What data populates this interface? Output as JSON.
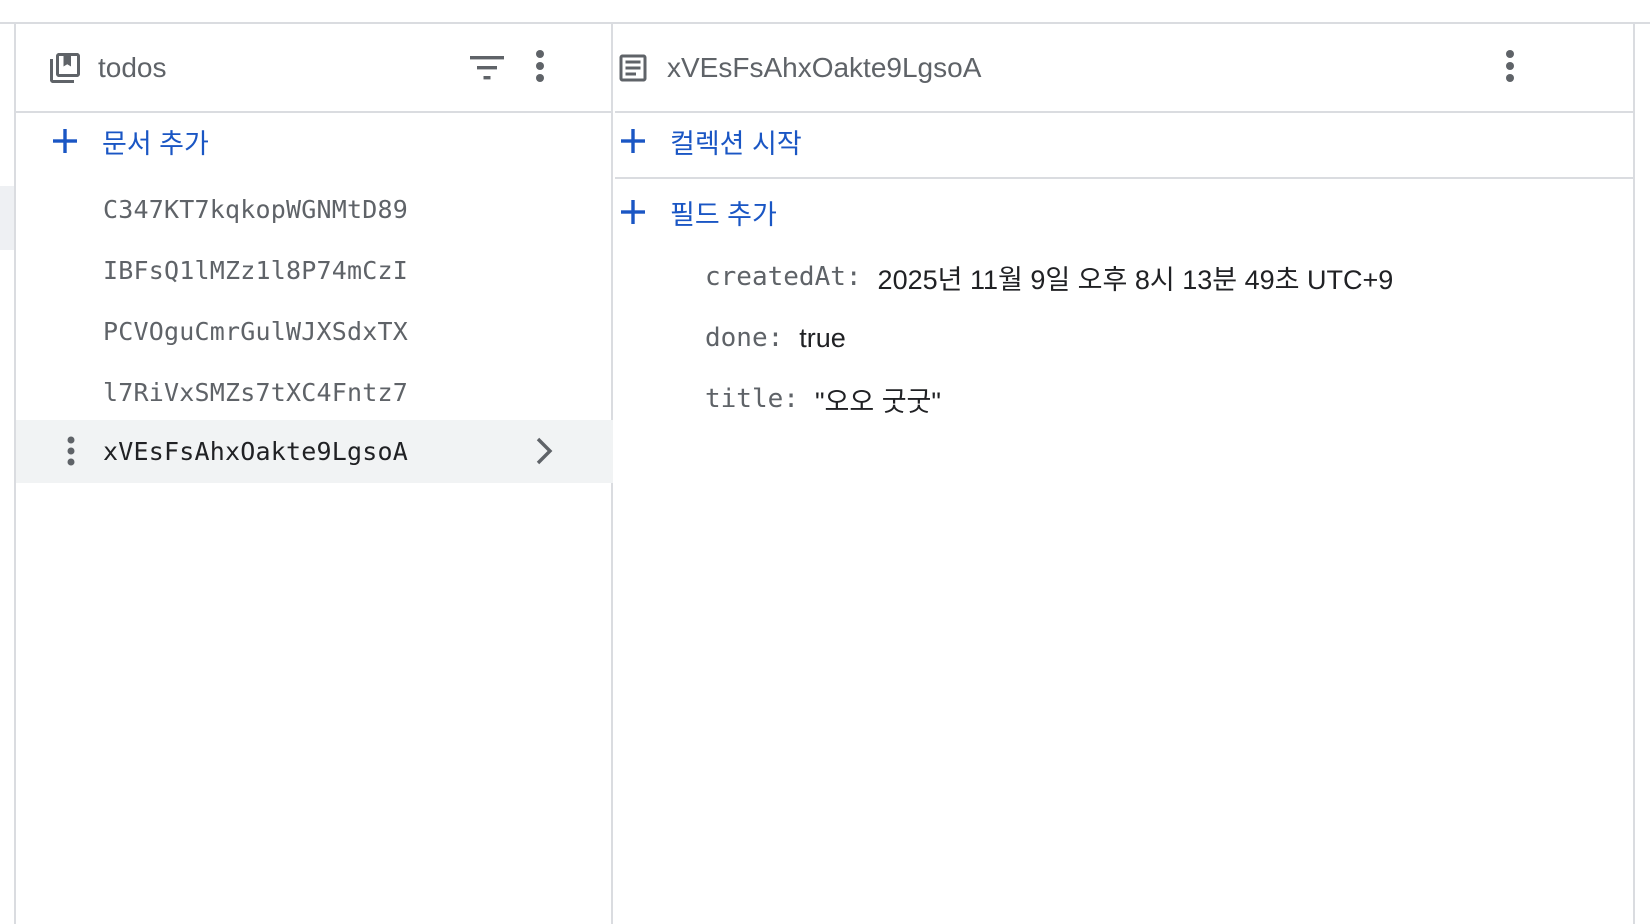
{
  "colors": {
    "accent": "#1a56c4",
    "border": "#dadce0",
    "selected_row": "#f1f3f4",
    "muted_text": "#5f6368",
    "text": "#202124"
  },
  "collection_panel": {
    "icon": "collection-icon",
    "title": "todos",
    "filter_icon": "filter-icon",
    "menu_icon": "more-vert-icon",
    "add_document_label": "문서 추가",
    "documents": [
      {
        "id": "C347KT7kqkopWGNMtD89",
        "selected": false
      },
      {
        "id": "IBFsQ1lMZz1l8P74mCzI",
        "selected": false
      },
      {
        "id": "PCVOguCmrGulWJXSdxTX",
        "selected": false
      },
      {
        "id": "l7RiVxSMZs7tXC4Fntz7",
        "selected": false
      },
      {
        "id": "xVEsFsAhxOakte9LgsoA",
        "selected": true
      }
    ]
  },
  "document_panel": {
    "icon": "document-icon",
    "title": "xVEsFsAhxOakte9LgsoA",
    "menu_icon": "more-vert-icon",
    "start_collection_label": "컬렉션 시작",
    "add_field_label": "필드 추가",
    "fields": [
      {
        "key": "createdAt",
        "value": "2025년 11월 9일 오후 8시 13분 49초 UTC+9"
      },
      {
        "key": "done",
        "value": "true"
      },
      {
        "key": "title",
        "value": "\"오오 굿굿\""
      }
    ]
  }
}
